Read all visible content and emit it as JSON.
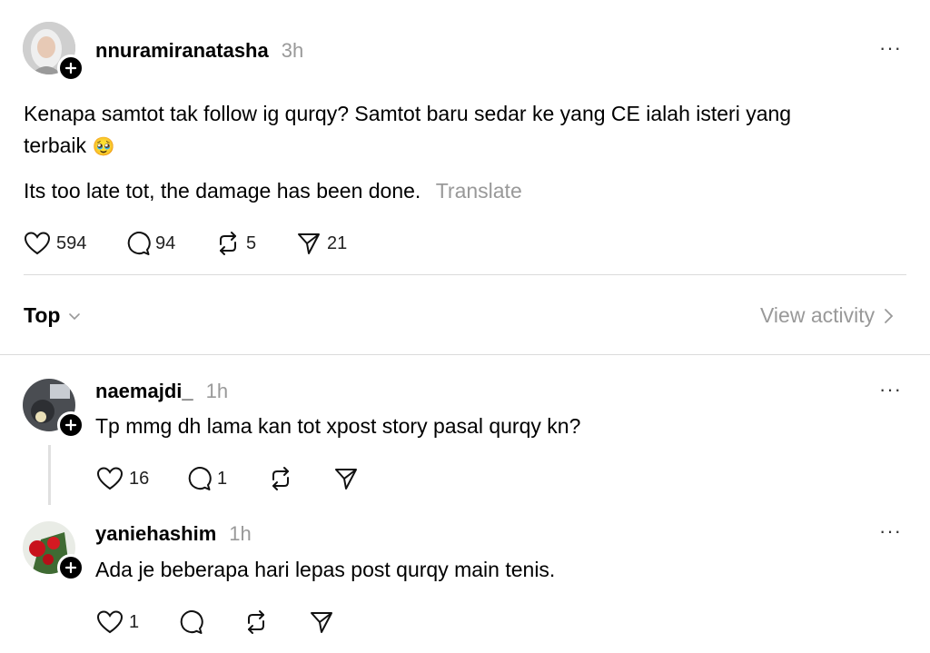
{
  "post": {
    "username": "nnuramiranatasha",
    "time": "3h",
    "more": "···",
    "text_line1": "Kenapa samtot tak follow ig qurqy? Samtot baru sedar ke yang CE ialah isteri yang",
    "text_line2": "terbaik",
    "emoji": "🥹",
    "text2": "Its too late tot, the damage has been done.",
    "translate": "Translate",
    "likes": "594",
    "replies": "94",
    "reposts": "5",
    "shares": "21"
  },
  "sort": {
    "label": "Top",
    "view_activity": "View activity"
  },
  "replies": [
    {
      "username": "naemajdi_",
      "time": "1h",
      "text": "Tp mmg dh lama kan tot xpost story pasal qurqy kn?",
      "likes": "16",
      "replies": "1"
    },
    {
      "username": "yaniehashim",
      "time": "1h",
      "text": "Ada je beberapa hari lepas post qurqy main tenis.",
      "likes": "1"
    }
  ],
  "colors": {
    "muted": "#999999",
    "divider": "#dbdbdb",
    "text": "#000000"
  }
}
